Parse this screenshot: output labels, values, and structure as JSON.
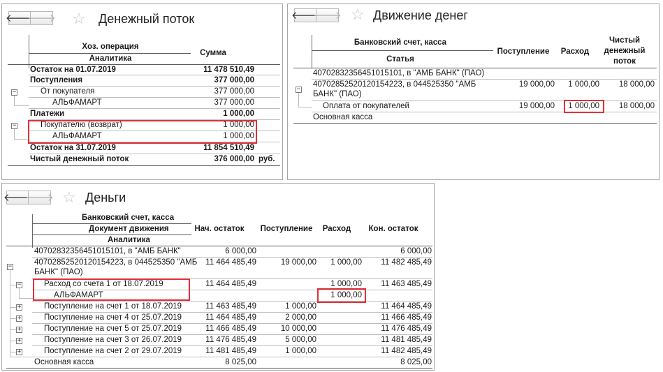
{
  "nav": {
    "back_icon": "arrow-left",
    "forward_icon": "arrow-right",
    "favorite_icon": "star"
  },
  "cashflow": {
    "title": "Денежный поток",
    "headers": {
      "operation": "Хоз. операция",
      "analytics": "Аналитика",
      "sum": "Сумма"
    },
    "rows": [
      {
        "label": "Остаток на 01.07.2019",
        "sum": "11 478 510,49",
        "bold": true
      },
      {
        "label": "Поступления",
        "sum": "377 000,00",
        "bold": true
      },
      {
        "label": "От покупателя",
        "sum": "377 000,00"
      },
      {
        "label": "АЛЬФАМАРТ",
        "sum": "377 000,00"
      },
      {
        "label": "Платежи",
        "sum": "1 000,00",
        "bold": true
      },
      {
        "label": "Покупателю (возврат)",
        "sum": "1 000,00"
      },
      {
        "label": "АЛЬФАМАРТ",
        "sum": "1 000,00"
      },
      {
        "label": "Остаток на 31.07.2019",
        "sum": "11 854 510,49",
        "bold": true
      },
      {
        "label": "Чистый денежный поток",
        "sum": "376 000,00",
        "unit": "руб.",
        "bold": true
      }
    ]
  },
  "movement": {
    "title": "Движение денег",
    "headers": {
      "account": "Банковский счет, касса",
      "item": "Статья",
      "income": "Поступление",
      "expense": "Расход",
      "net_line1": "Чистый",
      "net_line2": "денежный",
      "net_line3": "поток"
    },
    "rows": [
      {
        "label": "40702832356451015101, в \"АМБ БАНК\" (ПАО)"
      },
      {
        "label_line1": "40702852520120154223, в 044525350 \"АМБ",
        "label_line2": "БАНК\" (ПАО)",
        "income": "19 000,00",
        "expense": "1 000,00",
        "net": "18 000,00"
      },
      {
        "label": "Оплата от покупателей",
        "income": "19 000,00",
        "expense": "1 000,00",
        "net": "18 000,00"
      },
      {
        "label": "Основная касса"
      }
    ]
  },
  "money": {
    "title": "Деньги",
    "headers": {
      "account": "Банковский счет, касса",
      "document": "Документ движения",
      "analytics": "Аналитика",
      "start": "Нач. остаток",
      "income": "Поступление",
      "expense": "Расход",
      "end": "Кон. остаток"
    },
    "rows": [
      {
        "label": "40702832356451015101, в \"АМБ БАНК\"",
        "start": "6 000,00",
        "income": "",
        "expense": "",
        "end": "6 000,00"
      },
      {
        "label_line1": "40702852520120154223, в 044525350 \"АМБ",
        "label_line2": "БАНК\" (ПАО)",
        "start": "11 464 485,49",
        "income": "19 000,00",
        "expense": "1 000,00",
        "end": "11 482 485,49"
      },
      {
        "label": "Расход со счета 1 от 18.07.2019",
        "start": "11 464 485,49",
        "income": "",
        "expense": "1 000,00",
        "end": "11 463 485,49"
      },
      {
        "label": "АЛЬФАМАРТ",
        "start": "",
        "income": "",
        "expense": "1 000,00",
        "end": ""
      },
      {
        "label": "Поступление на счет 1 от 18.07.2019",
        "start": "11 463 485,49",
        "income": "1 000,00",
        "expense": "",
        "end": "11 464 485,49"
      },
      {
        "label": "Поступление на счет 4 от 25.07.2019",
        "start": "11 464 485,49",
        "income": "2 000,00",
        "expense": "",
        "end": "11 466 485,49"
      },
      {
        "label": "Поступление на счет 5 от 25.07.2019",
        "start": "11 466 485,49",
        "income": "10 000,00",
        "expense": "",
        "end": "11 476 485,49"
      },
      {
        "label": "Поступление на счет 3 от 26.07.2019",
        "start": "11 476 485,49",
        "income": "5 000,00",
        "expense": "",
        "end": "11 481 485,49"
      },
      {
        "label": "Поступление на счет 2 от 29.07.2019",
        "start": "11 481 485,49",
        "income": "1 000,00",
        "expense": "",
        "end": "11 482 485,49"
      },
      {
        "label": "Основная касса",
        "start": "8 025,00",
        "income": "",
        "expense": "",
        "end": "8 025,00"
      }
    ]
  },
  "colors": {
    "highlight": "#e0303a",
    "border": "#a6a6a6"
  }
}
